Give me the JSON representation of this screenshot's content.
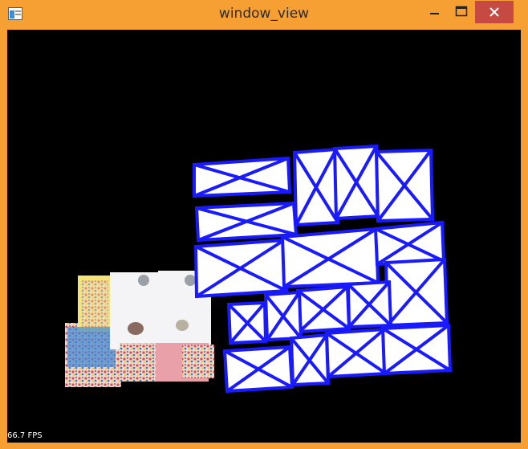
{
  "window": {
    "title": "window_view",
    "accent_color": "#f6a033",
    "close_color": "#c74a42",
    "icons": [
      "app-icon",
      "minimize-icon",
      "maximize-icon",
      "close-icon"
    ]
  },
  "viewport": {
    "background": "#000000",
    "fps_text": "66.7 FPS"
  }
}
